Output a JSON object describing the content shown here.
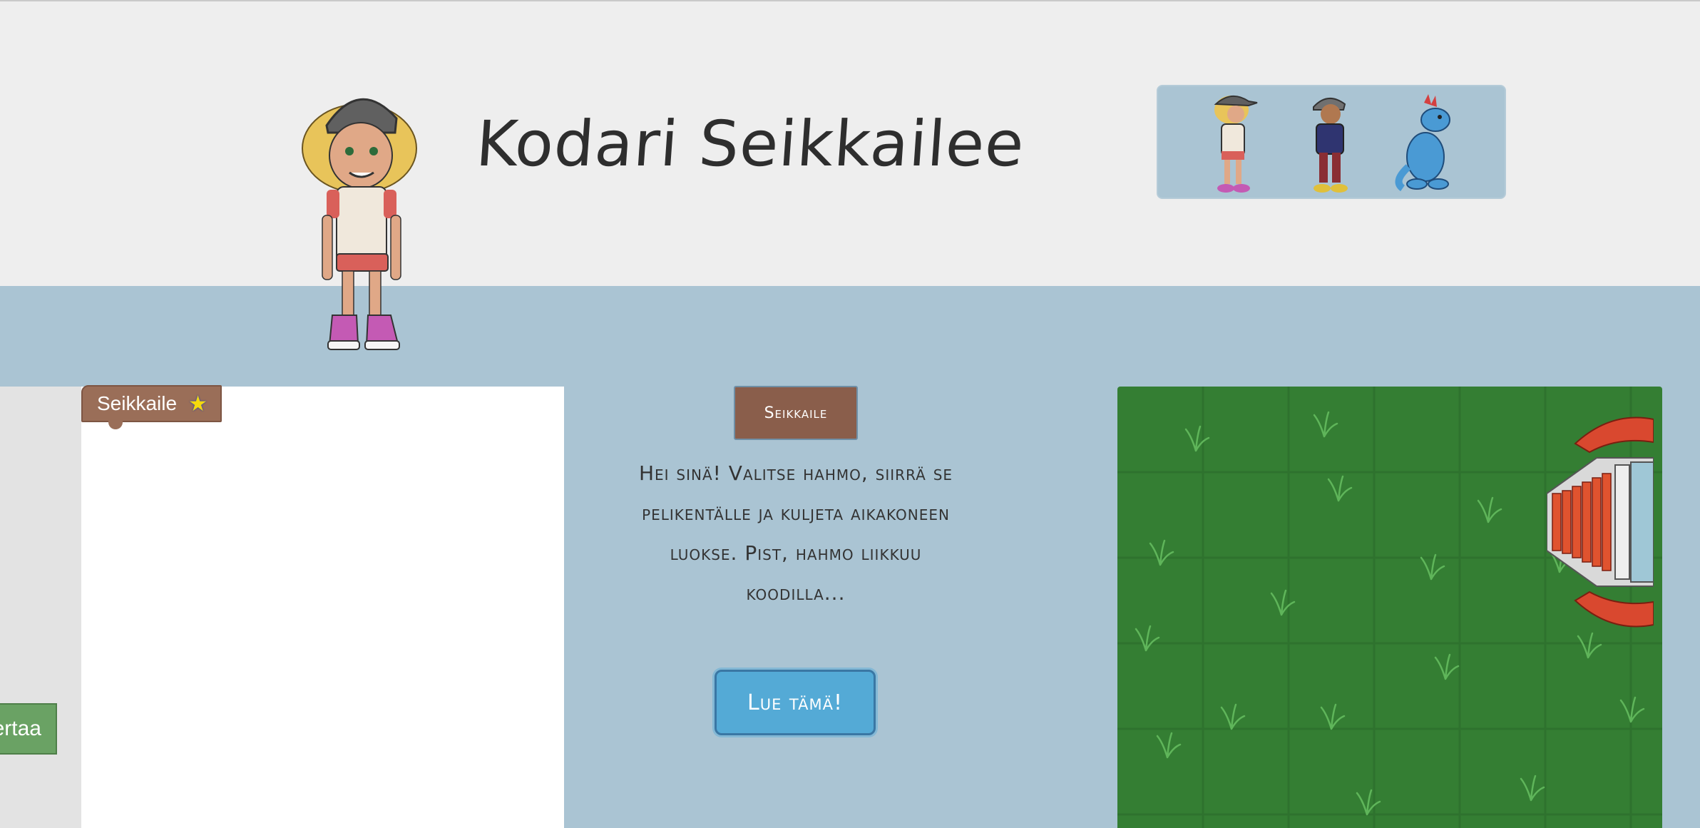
{
  "header": {
    "title": "Kodari Seikkailee"
  },
  "characters": [
    {
      "name": "girl-character"
    },
    {
      "name": "boy-character"
    },
    {
      "name": "dragon-character"
    }
  ],
  "workspace": {
    "start_block_label": "Seikkaile",
    "start_block_icon": "star-icon",
    "compare_button_label": "ertaa"
  },
  "controls": {
    "run_button_label": "Seikkaile",
    "intro_text": "Hei sinä! Valitse hahmo, siirrä se pelikentälle ja kuljeta aikakoneen luokse. Pist, hahmo liikkuu koodilla...",
    "read_button_label": "Lue tämä!"
  },
  "board": {
    "grass_color": "#347e33",
    "grid_color": "#2e722e",
    "object": "time-machine"
  },
  "colors": {
    "header_bg": "#eeeeee",
    "page_bg": "#aac4d3",
    "run_button": "#8a5e4b",
    "read_button": "#54aad6",
    "compare_button": "#6aa264"
  }
}
